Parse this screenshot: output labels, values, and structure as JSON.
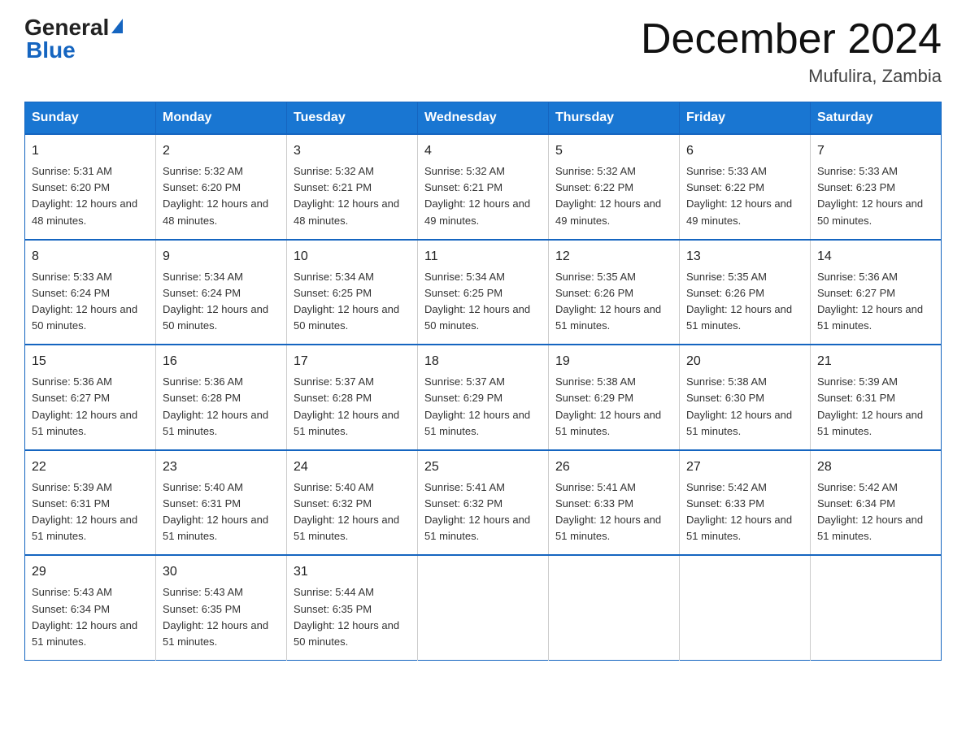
{
  "header": {
    "logo_general": "General",
    "logo_blue": "Blue",
    "title": "December 2024",
    "subtitle": "Mufulira, Zambia"
  },
  "calendar": {
    "days_of_week": [
      "Sunday",
      "Monday",
      "Tuesday",
      "Wednesday",
      "Thursday",
      "Friday",
      "Saturday"
    ],
    "weeks": [
      [
        {
          "day": "1",
          "sunrise": "5:31 AM",
          "sunset": "6:20 PM",
          "daylight": "12 hours and 48 minutes."
        },
        {
          "day": "2",
          "sunrise": "5:32 AM",
          "sunset": "6:20 PM",
          "daylight": "12 hours and 48 minutes."
        },
        {
          "day": "3",
          "sunrise": "5:32 AM",
          "sunset": "6:21 PM",
          "daylight": "12 hours and 48 minutes."
        },
        {
          "day": "4",
          "sunrise": "5:32 AM",
          "sunset": "6:21 PM",
          "daylight": "12 hours and 49 minutes."
        },
        {
          "day": "5",
          "sunrise": "5:32 AM",
          "sunset": "6:22 PM",
          "daylight": "12 hours and 49 minutes."
        },
        {
          "day": "6",
          "sunrise": "5:33 AM",
          "sunset": "6:22 PM",
          "daylight": "12 hours and 49 minutes."
        },
        {
          "day": "7",
          "sunrise": "5:33 AM",
          "sunset": "6:23 PM",
          "daylight": "12 hours and 50 minutes."
        }
      ],
      [
        {
          "day": "8",
          "sunrise": "5:33 AM",
          "sunset": "6:24 PM",
          "daylight": "12 hours and 50 minutes."
        },
        {
          "day": "9",
          "sunrise": "5:34 AM",
          "sunset": "6:24 PM",
          "daylight": "12 hours and 50 minutes."
        },
        {
          "day": "10",
          "sunrise": "5:34 AM",
          "sunset": "6:25 PM",
          "daylight": "12 hours and 50 minutes."
        },
        {
          "day": "11",
          "sunrise": "5:34 AM",
          "sunset": "6:25 PM",
          "daylight": "12 hours and 50 minutes."
        },
        {
          "day": "12",
          "sunrise": "5:35 AM",
          "sunset": "6:26 PM",
          "daylight": "12 hours and 51 minutes."
        },
        {
          "day": "13",
          "sunrise": "5:35 AM",
          "sunset": "6:26 PM",
          "daylight": "12 hours and 51 minutes."
        },
        {
          "day": "14",
          "sunrise": "5:36 AM",
          "sunset": "6:27 PM",
          "daylight": "12 hours and 51 minutes."
        }
      ],
      [
        {
          "day": "15",
          "sunrise": "5:36 AM",
          "sunset": "6:27 PM",
          "daylight": "12 hours and 51 minutes."
        },
        {
          "day": "16",
          "sunrise": "5:36 AM",
          "sunset": "6:28 PM",
          "daylight": "12 hours and 51 minutes."
        },
        {
          "day": "17",
          "sunrise": "5:37 AM",
          "sunset": "6:28 PM",
          "daylight": "12 hours and 51 minutes."
        },
        {
          "day": "18",
          "sunrise": "5:37 AM",
          "sunset": "6:29 PM",
          "daylight": "12 hours and 51 minutes."
        },
        {
          "day": "19",
          "sunrise": "5:38 AM",
          "sunset": "6:29 PM",
          "daylight": "12 hours and 51 minutes."
        },
        {
          "day": "20",
          "sunrise": "5:38 AM",
          "sunset": "6:30 PM",
          "daylight": "12 hours and 51 minutes."
        },
        {
          "day": "21",
          "sunrise": "5:39 AM",
          "sunset": "6:31 PM",
          "daylight": "12 hours and 51 minutes."
        }
      ],
      [
        {
          "day": "22",
          "sunrise": "5:39 AM",
          "sunset": "6:31 PM",
          "daylight": "12 hours and 51 minutes."
        },
        {
          "day": "23",
          "sunrise": "5:40 AM",
          "sunset": "6:31 PM",
          "daylight": "12 hours and 51 minutes."
        },
        {
          "day": "24",
          "sunrise": "5:40 AM",
          "sunset": "6:32 PM",
          "daylight": "12 hours and 51 minutes."
        },
        {
          "day": "25",
          "sunrise": "5:41 AM",
          "sunset": "6:32 PM",
          "daylight": "12 hours and 51 minutes."
        },
        {
          "day": "26",
          "sunrise": "5:41 AM",
          "sunset": "6:33 PM",
          "daylight": "12 hours and 51 minutes."
        },
        {
          "day": "27",
          "sunrise": "5:42 AM",
          "sunset": "6:33 PM",
          "daylight": "12 hours and 51 minutes."
        },
        {
          "day": "28",
          "sunrise": "5:42 AM",
          "sunset": "6:34 PM",
          "daylight": "12 hours and 51 minutes."
        }
      ],
      [
        {
          "day": "29",
          "sunrise": "5:43 AM",
          "sunset": "6:34 PM",
          "daylight": "12 hours and 51 minutes."
        },
        {
          "day": "30",
          "sunrise": "5:43 AM",
          "sunset": "6:35 PM",
          "daylight": "12 hours and 51 minutes."
        },
        {
          "day": "31",
          "sunrise": "5:44 AM",
          "sunset": "6:35 PM",
          "daylight": "12 hours and 50 minutes."
        },
        null,
        null,
        null,
        null
      ]
    ]
  }
}
